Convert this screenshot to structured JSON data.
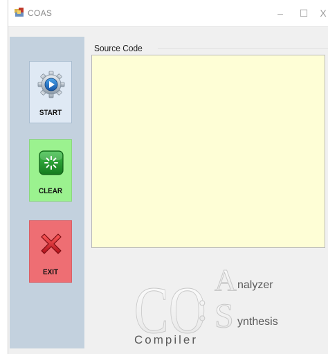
{
  "window": {
    "title": "COAS",
    "minimize_glyph": "–",
    "maximize_glyph": "☐",
    "close_glyph": "X"
  },
  "sidebar": {
    "buttons": [
      {
        "label": "START",
        "icon": "gear-play-icon",
        "color": "#dfe9f4"
      },
      {
        "label": "CLEAR",
        "icon": "loading-icon",
        "color": "#9bf28f"
      },
      {
        "label": "EXIT",
        "icon": "red-x-icon",
        "color": "#ee6e73"
      }
    ]
  },
  "source": {
    "group_title": "Source Code",
    "value": "",
    "background": "#fefed6"
  },
  "logo": {
    "letters": "CO",
    "colon": ":",
    "a_letter": "A",
    "a_rest": "nalyzer",
    "s_letter": "S",
    "s_rest": "ynthesis",
    "bottom": "Compiler"
  }
}
